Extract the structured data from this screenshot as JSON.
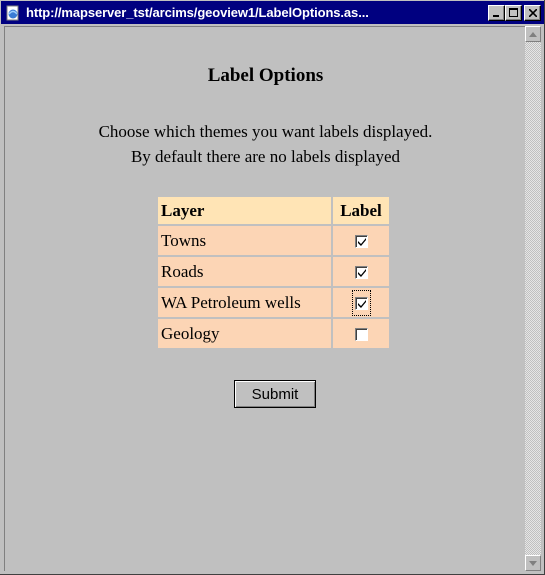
{
  "window": {
    "title": "http://mapserver_tst/arcims/geoview1/LabelOptions.as...",
    "icon": "ie-page-icon",
    "buttons": [
      "minimize",
      "maximize",
      "close"
    ]
  },
  "page": {
    "title": "Label Options",
    "intro_line1": "Choose which themes you want labels displayed.",
    "intro_line2": "By default there are no labels displayed"
  },
  "table": {
    "headers": {
      "layer": "Layer",
      "label": "Label"
    },
    "rows": [
      {
        "layer": "Towns",
        "checked": true
      },
      {
        "layer": "Roads",
        "checked": true
      },
      {
        "layer": "WA Petroleum wells",
        "checked": true,
        "focused": true
      },
      {
        "layer": "Geology",
        "checked": false
      }
    ]
  },
  "form": {
    "submit_label": "Submit"
  },
  "colors": {
    "title_bar": "#000080",
    "header_bg": "#ffe4b5",
    "cell_bg": "#fcd5b5",
    "face": "#c0c0c0"
  }
}
